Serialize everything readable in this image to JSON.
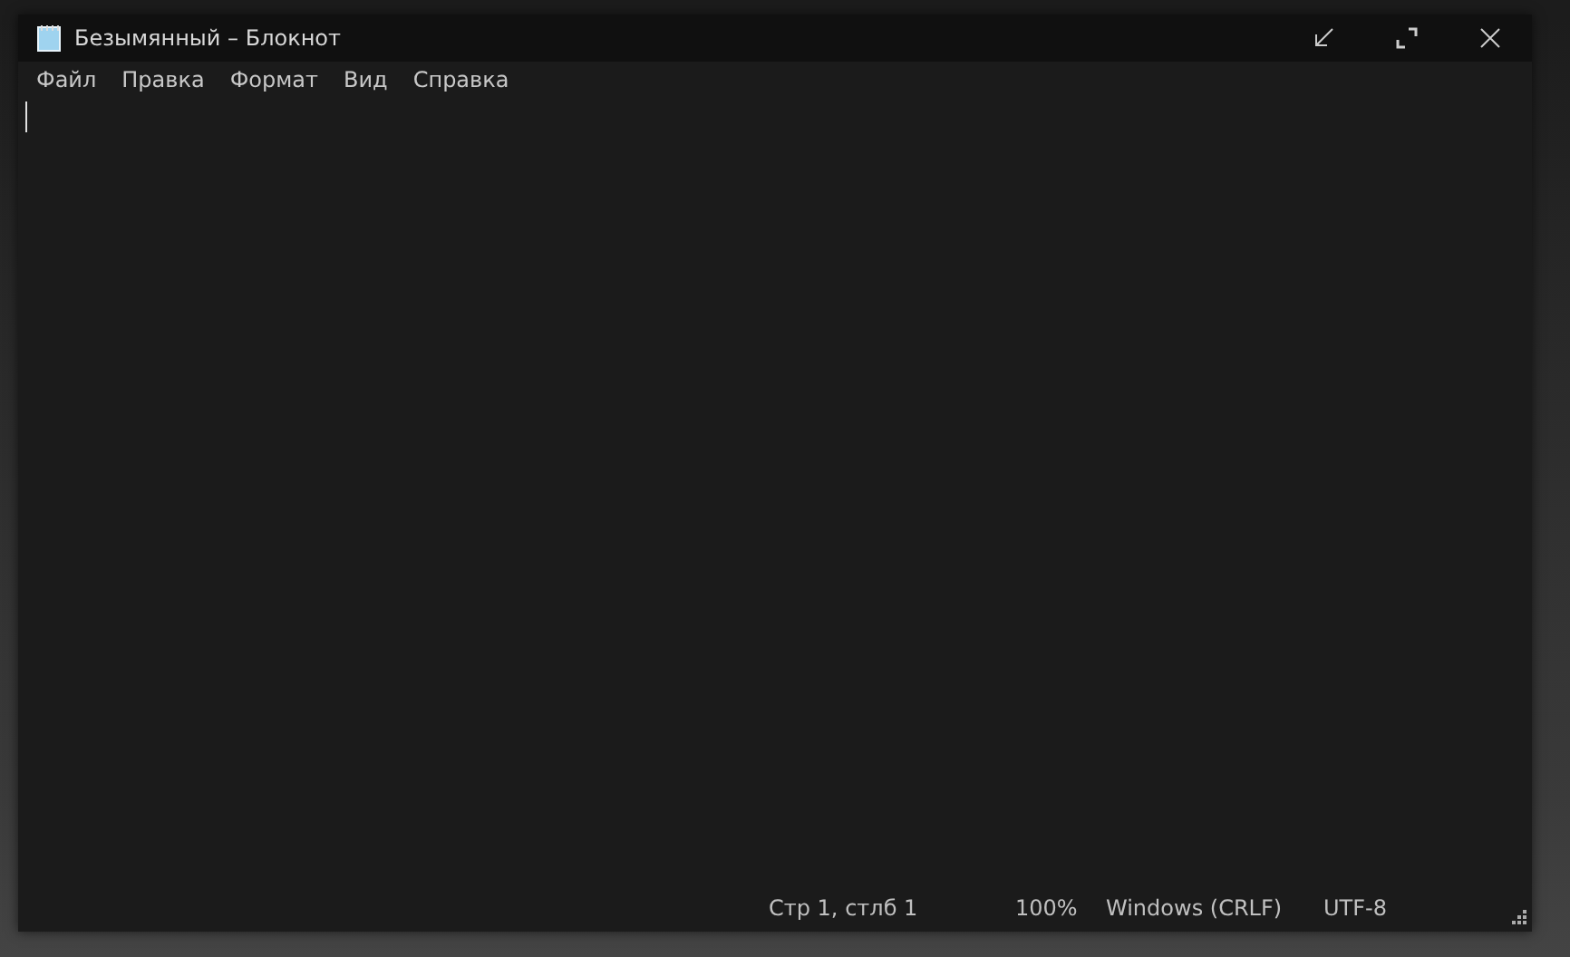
{
  "window": {
    "title": "Безымянный – Блокнот"
  },
  "menu": [
    "Файл",
    "Правка",
    "Формат",
    "Вид",
    "Справка"
  ],
  "status_bar": [
    "Стр 1, стлб 1",
    "100%",
    "Windows (CRLF)",
    "UTF-8"
  ]
}
